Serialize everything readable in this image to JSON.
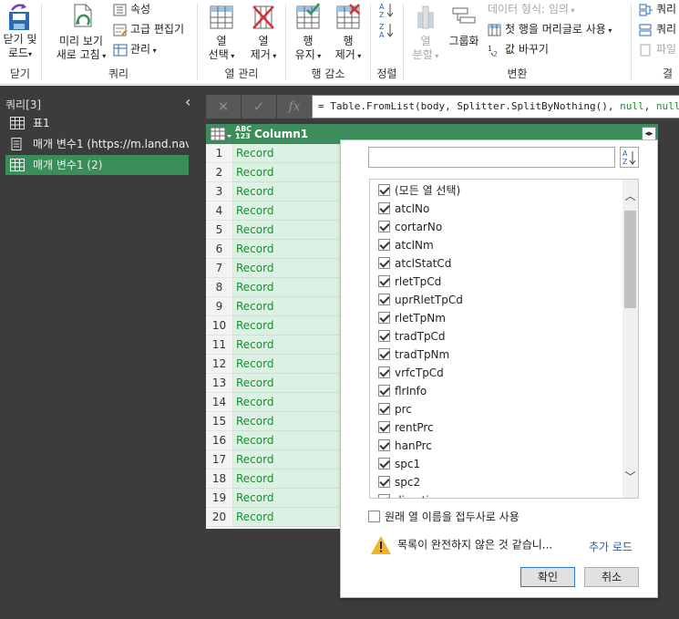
{
  "ribbon": {
    "close_group": {
      "btn1": "닫기 및",
      "btn2": "로드",
      "label": "닫기"
    },
    "query_group": {
      "preview1": "미리 보기",
      "preview2": "새로 고침",
      "props": "속성",
      "adv_editor": "고급 편집기",
      "manage": "관리",
      "label": "쿼리"
    },
    "cols_group": {
      "choose1": "열",
      "choose2": "선택",
      "remove1": "열",
      "remove2": "제거",
      "label": "열 관리"
    },
    "rows_group": {
      "keep1": "행",
      "keep2": "유지",
      "remove1": "행",
      "remove2": "제거",
      "label": "행 감소"
    },
    "sort_group": {
      "label": "정렬"
    },
    "transform_group": {
      "split1": "열",
      "split2": "분할",
      "group_by": "그룹화",
      "data_type": "데이터 형식: 임의",
      "first_row": "첫 행을 머리글로 사용",
      "replace": "값 바꾸기",
      "label": "변환"
    },
    "combine_group": {
      "queries1": "쿼리",
      "queries2": "쿼리",
      "file": "파일",
      "label": "결"
    }
  },
  "queries_panel": {
    "title": "쿼리[3]",
    "items": [
      {
        "label": "표1"
      },
      {
        "label": "매개 변수1 (https://m.land.nav..."
      },
      {
        "label": "매개 변수1 (2)"
      }
    ]
  },
  "formula_bar": {
    "fx": "fx",
    "formula_prefix": "= Table.FromList(body, Splitter.SplitByNothing(), ",
    "formula_null1": "null",
    "formula_sep": ", ",
    "formula_null2": "null"
  },
  "grid": {
    "type_top": "ABC",
    "type_bottom": "123",
    "column": "Column1",
    "rows": [
      {
        "n": "1",
        "v": "Record"
      },
      {
        "n": "2",
        "v": "Record"
      },
      {
        "n": "3",
        "v": "Record"
      },
      {
        "n": "4",
        "v": "Record"
      },
      {
        "n": "5",
        "v": "Record"
      },
      {
        "n": "6",
        "v": "Record"
      },
      {
        "n": "7",
        "v": "Record"
      },
      {
        "n": "8",
        "v": "Record"
      },
      {
        "n": "9",
        "v": "Record"
      },
      {
        "n": "10",
        "v": "Record"
      },
      {
        "n": "11",
        "v": "Record"
      },
      {
        "n": "12",
        "v": "Record"
      },
      {
        "n": "13",
        "v": "Record"
      },
      {
        "n": "14",
        "v": "Record"
      },
      {
        "n": "15",
        "v": "Record"
      },
      {
        "n": "16",
        "v": "Record"
      },
      {
        "n": "17",
        "v": "Record"
      },
      {
        "n": "18",
        "v": "Record"
      },
      {
        "n": "19",
        "v": "Record"
      },
      {
        "n": "20",
        "v": "Record"
      }
    ]
  },
  "expand_dropdown": {
    "sort_top": "A",
    "sort_bottom": "Z",
    "search_value": "",
    "columns": [
      {
        "label": "(모든 열 선택)",
        "checked": true
      },
      {
        "label": "atclNo",
        "checked": true
      },
      {
        "label": "cortarNo",
        "checked": true
      },
      {
        "label": "atclNm",
        "checked": true
      },
      {
        "label": "atclStatCd",
        "checked": true
      },
      {
        "label": "rletTpCd",
        "checked": true
      },
      {
        "label": "uprRletTpCd",
        "checked": true
      },
      {
        "label": "rletTpNm",
        "checked": true
      },
      {
        "label": "tradTpCd",
        "checked": true
      },
      {
        "label": "tradTpNm",
        "checked": true
      },
      {
        "label": "vrfcTpCd",
        "checked": true
      },
      {
        "label": "flrInfo",
        "checked": true
      },
      {
        "label": "prc",
        "checked": true
      },
      {
        "label": "rentPrc",
        "checked": true
      },
      {
        "label": "hanPrc",
        "checked": true
      },
      {
        "label": "spc1",
        "checked": true
      },
      {
        "label": "spc2",
        "checked": true
      },
      {
        "label": "direction",
        "checked": true
      }
    ],
    "use_original_prefix": "원래 열 이름을 접두사로 사용",
    "use_original_checked": false,
    "warning": "목록이 완전하지 않은 것 같습니...",
    "load_more": "추가 로드",
    "ok": "확인",
    "cancel": "취소"
  },
  "colors": {
    "accent_green": "#3b8d5a",
    "record_text": "#1a8e2e",
    "link_blue": "#1f5fb8"
  }
}
